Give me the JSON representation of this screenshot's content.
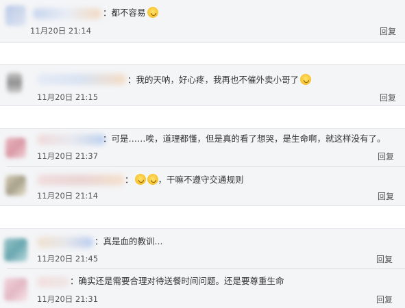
{
  "comments": [
    {
      "text": "都不容易",
      "emoji_count": 1,
      "time": "11月20日 21:14",
      "reply": "回复"
    },
    {
      "text": "我的天呐，好心疼，我再也不催外卖小哥了",
      "emoji_count": 1,
      "time": "11月20日 21:15",
      "reply": "回复"
    },
    {
      "text": "可是……唉，道理都懂，但是真的看了想哭，是生命啊，就这样没有了。",
      "emoji_count": 0,
      "time": "11月20日 21:37",
      "reply": "回复"
    },
    {
      "text": "，干嘛不遵守交通规则",
      "emoji_count": 2,
      "time": "11月20日 21:14",
      "reply": "回复"
    },
    {
      "text": "真是血的教训...",
      "emoji_count": 0,
      "time": "11月20日 21:45",
      "reply": "回复"
    },
    {
      "text": "确实还是需要合理对待送餐时间问题。还是要尊重生命",
      "emoji_count": 0,
      "time": "11月20日 21:31",
      "reply": "回复"
    }
  ],
  "separator": "：",
  "colors": {
    "panel_bg": "#f4f5f7",
    "text": "#333333",
    "meta": "#555555",
    "divider": "#e3e4e8"
  }
}
